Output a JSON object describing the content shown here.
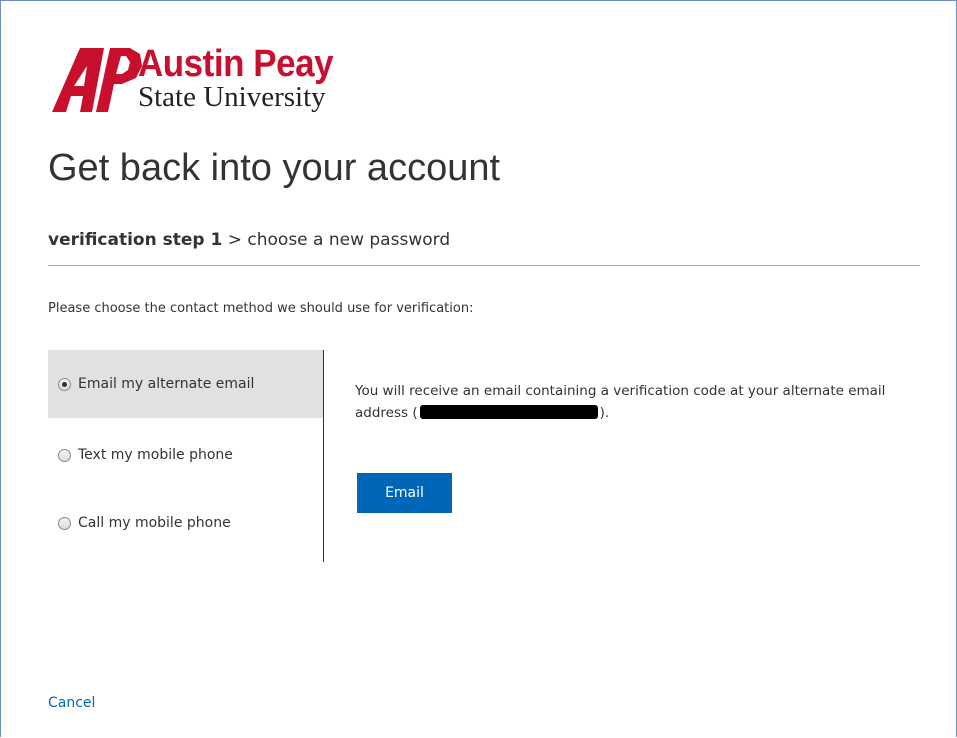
{
  "brand": {
    "logo_line1": "Austin Peay",
    "logo_line2": "State University",
    "accent_color": "#c8102e"
  },
  "page": {
    "title": "Get back into your account",
    "steps": {
      "current": "verification step 1",
      "separator": ">",
      "next": "choose a new password"
    },
    "instruction": "Please choose the contact method we should use for verification:"
  },
  "methods": [
    {
      "label": "Email my alternate email",
      "selected": true
    },
    {
      "label": "Text my mobile phone",
      "selected": false
    },
    {
      "label": "Call my mobile phone",
      "selected": false
    }
  ],
  "detail": {
    "text_before": "You will receive an email containing a verification code at your alternate email address (",
    "text_after": ").",
    "button_label": "Email",
    "button_color": "#0067b8"
  },
  "footer": {
    "cancel_label": "Cancel",
    "link_color": "#0067b8"
  }
}
